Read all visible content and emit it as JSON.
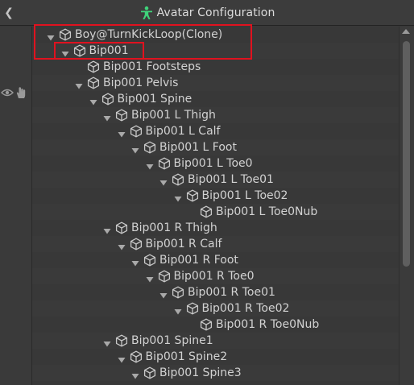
{
  "window": {
    "title": "Avatar Configuration"
  },
  "icons": {
    "back": "chevron-left-icon",
    "title": "avatar-figure-icon",
    "node": "cube-icon",
    "expand": "triangle-down-icon",
    "visibility": "eye-icon",
    "pickable": "hand-icon"
  },
  "colors": {
    "highlight": "#e0121f",
    "avatar_icon": "#3fd37a"
  },
  "hierarchy": [
    {
      "label": "Boy@TurnKickLoop(Clone)",
      "depth": 0,
      "expanded": true
    },
    {
      "label": "Bip001",
      "depth": 1,
      "expanded": true
    },
    {
      "label": "Bip001 Footsteps",
      "depth": 2,
      "expanded": false
    },
    {
      "label": "Bip001 Pelvis",
      "depth": 2,
      "expanded": true
    },
    {
      "label": "Bip001 Spine",
      "depth": 3,
      "expanded": true
    },
    {
      "label": "Bip001 L Thigh",
      "depth": 4,
      "expanded": true
    },
    {
      "label": "Bip001 L Calf",
      "depth": 5,
      "expanded": true
    },
    {
      "label": "Bip001 L Foot",
      "depth": 6,
      "expanded": true
    },
    {
      "label": "Bip001 L Toe0",
      "depth": 7,
      "expanded": true
    },
    {
      "label": "Bip001 L Toe01",
      "depth": 8,
      "expanded": true
    },
    {
      "label": "Bip001 L Toe02",
      "depth": 9,
      "expanded": true
    },
    {
      "label": "Bip001 L Toe0Nub",
      "depth": 10,
      "expanded": false
    },
    {
      "label": "Bip001 R Thigh",
      "depth": 4,
      "expanded": true
    },
    {
      "label": "Bip001 R Calf",
      "depth": 5,
      "expanded": true
    },
    {
      "label": "Bip001 R Foot",
      "depth": 6,
      "expanded": true
    },
    {
      "label": "Bip001 R Toe0",
      "depth": 7,
      "expanded": true
    },
    {
      "label": "Bip001 R Toe01",
      "depth": 8,
      "expanded": true
    },
    {
      "label": "Bip001 R Toe02",
      "depth": 9,
      "expanded": true
    },
    {
      "label": "Bip001 R Toe0Nub",
      "depth": 10,
      "expanded": false
    },
    {
      "label": "Bip001 Spine1",
      "depth": 4,
      "expanded": true
    },
    {
      "label": "Bip001 Spine2",
      "depth": 5,
      "expanded": true
    },
    {
      "label": "Bip001 Spine3",
      "depth": 6,
      "expanded": true
    }
  ]
}
